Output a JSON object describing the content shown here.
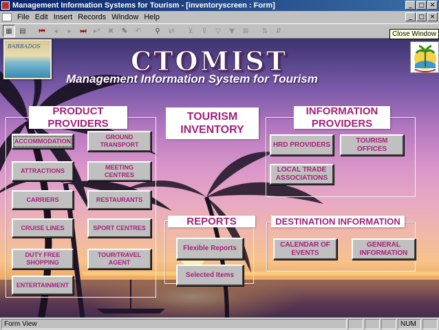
{
  "window": {
    "title": "Management Information Systems for Tourism - [inventoryscreen : Form]",
    "controls": [
      "_",
      "□",
      "✕"
    ]
  },
  "menubar": {
    "items": [
      "File",
      "Edit",
      "Insert",
      "Records",
      "Window",
      "Help"
    ],
    "doc_controls": [
      "_",
      "□",
      "✕"
    ]
  },
  "toolbar": {
    "tooltip": "Close Window"
  },
  "header": {
    "logo_left_text": "BARBADOS",
    "brand": "CTOMIST",
    "subtitle": "Management Information System for Tourism"
  },
  "product_providers": {
    "label": "PRODUCT PROVIDERS",
    "buttons": [
      "ACCOMMODATION",
      "GROUND TRANSPORT",
      "ATTRACTIONS",
      "MEETING CENTRES",
      "CARRIERS",
      "RESTAURANTS",
      "CRUISE LINES",
      "SPORT CENTRES",
      "DUTY FREE SHOPPING",
      "TOUR/TRAVEL AGENT",
      "ENTERTAINMENT"
    ]
  },
  "tourism_inventory": {
    "label": "TOURISM INVENTORY"
  },
  "information_providers": {
    "label": "INFORMATION PROVIDERS",
    "buttons": [
      "HRD PROVIDERS",
      "TOURISM OFFICES",
      "LOCAL TRADE ASSOCIATIONS"
    ]
  },
  "reports": {
    "label": "REPORTS",
    "buttons": [
      "Flexible Reports",
      "Selected Items"
    ]
  },
  "destination_information": {
    "label": "DESTINATION INFORMATION",
    "buttons": [
      "CALENDAR OF EVENTS",
      "GENERAL INFORMATION"
    ]
  },
  "statusbar": {
    "text": "Form View",
    "num": "NUM"
  }
}
